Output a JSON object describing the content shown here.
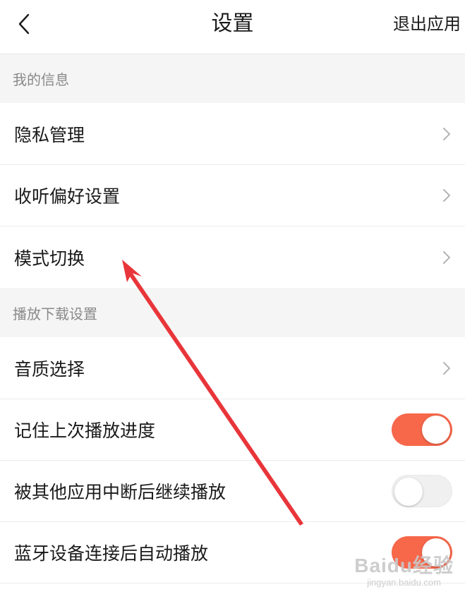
{
  "header": {
    "title": "设置",
    "exit_label": "退出应用",
    "back_icon": "chevron-left-icon"
  },
  "sections": [
    {
      "title": "我的信息",
      "rows": [
        {
          "label": "隐私管理",
          "control": "chevron"
        },
        {
          "label": "收听偏好设置",
          "control": "chevron"
        },
        {
          "label": "模式切换",
          "control": "chevron"
        }
      ]
    },
    {
      "title": "播放下载设置",
      "rows": [
        {
          "label": "音质选择",
          "control": "chevron"
        },
        {
          "label": "记住上次播放进度",
          "control": "toggle",
          "on": true
        },
        {
          "label": "被其他应用中断后继续播放",
          "control": "toggle",
          "on": false
        },
        {
          "label": "蓝牙设备连接后自动播放",
          "control": "toggle",
          "on": true
        }
      ]
    }
  ],
  "colors": {
    "accent": "#f7674a",
    "toggle_off": "#f0f0f0",
    "section_bg": "#f5f5f5",
    "section_text": "#8a8a8a",
    "arrow": "#e8353a",
    "chevron": "#b3b3b3"
  },
  "watermark": {
    "main": "Baidu经验",
    "sub": "jingyan.baidu.com"
  }
}
